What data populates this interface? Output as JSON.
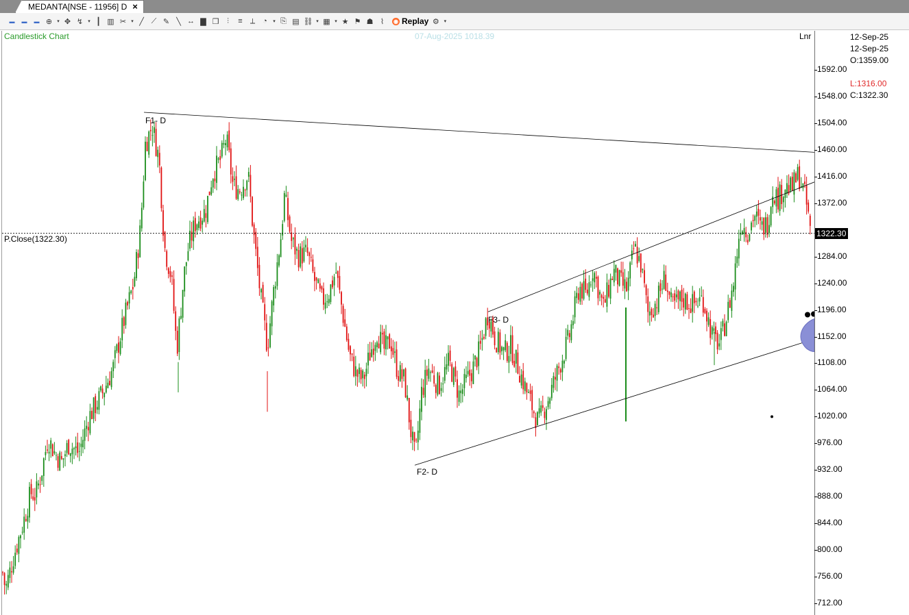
{
  "tab": {
    "title": "MEDANTA[NSE - 11956] D",
    "close_label": "×"
  },
  "toolbar": {
    "icons": [
      "time-frame-icon",
      "minute-icon",
      "daily-icon",
      "pointer-icon",
      "crosshair-icon",
      "cursor-mode-icon",
      "bar-chart-icon",
      "candle-chart-icon",
      "tool-icon",
      "trend-line-icon",
      "ray-icon",
      "horizontal-line-icon",
      "volume-icon",
      "object-icon",
      "fibonacci-icon",
      "channel-icon",
      "pencil-icon",
      "measure-icon",
      "shape-icon",
      "template-icon",
      "link-icon",
      "layout-icon",
      "star-icon",
      "alert-icon",
      "portfolio-icon",
      "indicator-icon"
    ],
    "replay_label": "Replay"
  },
  "chart": {
    "type_label": "Candlestick Chart",
    "cursor_info": "07-Aug-2025 1018.39",
    "scale_type": "Lnr",
    "prev_close_label": "P.Close(1322.30)",
    "last_price": "1322.30"
  },
  "info_panel": {
    "date1": "12-Sep-25",
    "date2": "12-Sep-25",
    "open": "O:1359.00",
    "low": "L:1316.00",
    "close": "C:1322.30"
  },
  "colors": {
    "up": "#1a8c1a",
    "down": "#e01010",
    "trendline": "#000000",
    "highlight": "#8a8fd6"
  },
  "fib_labels": {
    "f1": "F1- D",
    "f2": "F2- D",
    "f3": "F3- D"
  },
  "chart_data": {
    "type": "candlestick",
    "y_ticks": [
      "1592.00",
      "1548.00",
      "1504.00",
      "1460.00",
      "1416.00",
      "1372.00",
      "1284.00",
      "1240.00",
      "1196.00",
      "1152.00",
      "1108.00",
      "1064.00",
      "1020.00",
      "976.00",
      "932.00",
      "888.00",
      "844.00",
      "800.00",
      "756.00",
      "712.00"
    ],
    "ylim": [
      700,
      1650
    ],
    "close_anchors": [
      [
        0,
        790
      ],
      [
        8,
        735
      ],
      [
        20,
        790
      ],
      [
        35,
        850
      ],
      [
        45,
        895
      ],
      [
        52,
        890
      ],
      [
        60,
        925
      ],
      [
        70,
        985
      ],
      [
        80,
        960
      ],
      [
        90,
        945
      ],
      [
        100,
        975
      ],
      [
        115,
        960
      ],
      [
        130,
        1020
      ],
      [
        150,
        1060
      ],
      [
        165,
        1100
      ],
      [
        180,
        1175
      ],
      [
        195,
        1240
      ],
      [
        205,
        1330
      ],
      [
        212,
        1470
      ],
      [
        222,
        1500
      ],
      [
        232,
        1445
      ],
      [
        240,
        1300
      ],
      [
        250,
        1250
      ],
      [
        258,
        1130
      ],
      [
        268,
        1250
      ],
      [
        275,
        1300
      ],
      [
        285,
        1340
      ],
      [
        300,
        1360
      ],
      [
        310,
        1420
      ],
      [
        322,
        1445
      ],
      [
        330,
        1480
      ],
      [
        340,
        1400
      ],
      [
        350,
        1395
      ],
      [
        362,
        1420
      ],
      [
        370,
        1320
      ],
      [
        380,
        1220
      ],
      [
        390,
        1135
      ],
      [
        400,
        1235
      ],
      [
        410,
        1320
      ],
      [
        415,
        1385
      ],
      [
        425,
        1310
      ],
      [
        435,
        1285
      ],
      [
        448,
        1290
      ],
      [
        460,
        1240
      ],
      [
        470,
        1210
      ],
      [
        480,
        1225
      ],
      [
        490,
        1260
      ],
      [
        500,
        1190
      ],
      [
        510,
        1120
      ],
      [
        520,
        1090
      ],
      [
        530,
        1080
      ],
      [
        540,
        1125
      ],
      [
        550,
        1160
      ],
      [
        560,
        1130
      ],
      [
        570,
        1145
      ],
      [
        580,
        1095
      ],
      [
        590,
        1080
      ],
      [
        600,
        990
      ],
      [
        606,
        950
      ],
      [
        615,
        1060
      ],
      [
        625,
        1100
      ],
      [
        640,
        1070
      ],
      [
        655,
        1110
      ],
      [
        670,
        1055
      ],
      [
        690,
        1100
      ],
      [
        700,
        1130
      ],
      [
        712,
        1192
      ],
      [
        722,
        1150
      ],
      [
        735,
        1125
      ],
      [
        745,
        1135
      ],
      [
        755,
        1105
      ],
      [
        770,
        1055
      ],
      [
        785,
        1010
      ],
      [
        800,
        1050
      ],
      [
        815,
        1100
      ],
      [
        830,
        1150
      ],
      [
        845,
        1235
      ],
      [
        855,
        1220
      ],
      [
        865,
        1265
      ],
      [
        880,
        1200
      ],
      [
        895,
        1260
      ],
      [
        905,
        1240
      ],
      [
        915,
        1230
      ],
      [
        925,
        1300
      ],
      [
        935,
        1270
      ],
      [
        945,
        1190
      ],
      [
        958,
        1210
      ],
      [
        970,
        1250
      ],
      [
        980,
        1200
      ],
      [
        995,
        1215
      ],
      [
        1010,
        1205
      ],
      [
        1025,
        1215
      ],
      [
        1040,
        1150
      ],
      [
        1050,
        1140
      ],
      [
        1060,
        1185
      ],
      [
        1070,
        1240
      ],
      [
        1080,
        1340
      ],
      [
        1092,
        1325
      ],
      [
        1100,
        1355
      ],
      [
        1110,
        1330
      ],
      [
        1120,
        1340
      ],
      [
        1127,
        1395
      ],
      [
        1135,
        1380
      ],
      [
        1145,
        1400
      ],
      [
        1155,
        1395
      ],
      [
        1165,
        1420
      ],
      [
        1175,
        1380
      ],
      [
        1183,
        1322
      ]
    ],
    "extra_wicks": [
      [
        260,
        1110,
        1060
      ],
      [
        390,
        1095,
        1028
      ],
      [
        913,
        1200,
        1012
      ],
      [
        1042,
        1160,
        1105
      ]
    ]
  }
}
